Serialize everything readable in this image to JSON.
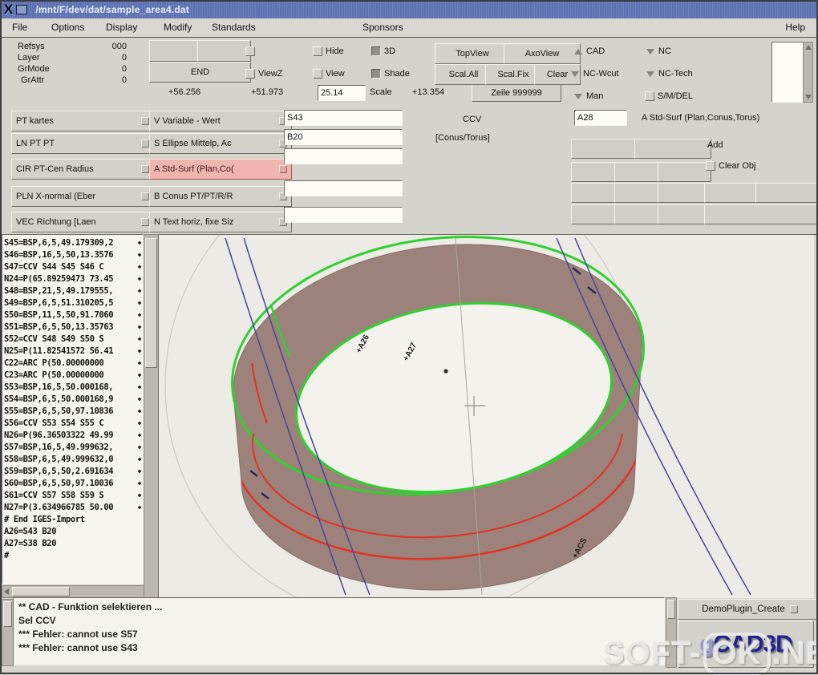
{
  "window": {
    "logo": "X",
    "title": "/mnt/F/dev/dat/sample_area4.dat",
    "buttons": {
      "minimize": "•",
      "maximize": "▫",
      "close": "✕"
    }
  },
  "menubar": {
    "items": [
      "File",
      "Options",
      "Display",
      "Modify",
      "Standards",
      "Sponsors"
    ],
    "help": "Help"
  },
  "toolbar": {
    "stats": [
      {
        "label": "Refsys",
        "value": "000"
      },
      {
        "label": "Layer",
        "value": "0"
      },
      {
        "label": "GrMode",
        "value": "0"
      },
      {
        "label": "GrAttr",
        "value": "0"
      }
    ],
    "end_button": "END",
    "coord_x": "+56.256",
    "coord_y": "+51.973",
    "scale_value": "25.14",
    "scale_label": "Scale",
    "coord_z": "+13.354",
    "line_label": "Zeile 999999",
    "toggles": {
      "viewz": "ViewZ",
      "hide": "Hide",
      "view": "View",
      "threed": "3D",
      "shade": "Shade",
      "smdel": "S/M/DEL"
    },
    "view_buttons": [
      "TopView",
      "AxoView",
      "Scal.All",
      "Scal.Fix",
      "Clear"
    ],
    "modes": [
      "CAD",
      "NC",
      "NC-Wcut",
      "NC-Tech",
      "Man"
    ]
  },
  "form": {
    "col1": [
      "PT kartes",
      "LN PT  PT",
      "CIR PT-Cen Radius",
      "PLN X-normal (Eber",
      "VEC Richtung  [Laen"
    ],
    "col2": [
      "V Variable - Wert",
      "S Ellipse Mittelp, Ac",
      "A Std-Surf (Plan,Co(",
      "B Conus PT/PT/R/R",
      "N Text horiz, fixe Siz"
    ],
    "inputs": [
      "S43",
      "B20",
      "",
      "",
      ""
    ],
    "ccv_title": "CCV",
    "ccv_sub": "[Conus/Torus]",
    "ccv_dots": [
      "·",
      "·",
      "·",
      "·"
    ],
    "obj_input": "A28",
    "obj_label": "A Std-Surf (Plan,Conus,Torus)",
    "add_label": "Add",
    "clear_obj": "Clear Obj"
  },
  "history": {
    "lines": [
      {
        "text": "S45=BSP,6,5,49.179309,2",
        "mark": "◆"
      },
      {
        "text": "S46=BSP,16,5,50,13.3576",
        "mark": "◆"
      },
      {
        "text": "S47=CCV S44 S45 S46 C",
        "mark": "◆"
      },
      {
        "text": "N24=P(65.89259473 73.45",
        "mark": "◆"
      },
      {
        "text": "S48=BSP,21,5,49.179555,",
        "mark": "◆"
      },
      {
        "text": "S49=BSP,6,5,51.310205,5",
        "mark": "◆"
      },
      {
        "text": "S50=BSP,11,5,50,91.7060",
        "mark": "◆"
      },
      {
        "text": "S51=BSP,6,5,50,13.35763",
        "mark": "◆"
      },
      {
        "text": "S52=CCV S48 S49 S50 S",
        "mark": "◆"
      },
      {
        "text": "N25=P(11.82541572 56.41",
        "mark": "◆"
      },
      {
        "text": "C22=ARC P(50.00000000",
        "mark": "◆"
      },
      {
        "text": "C23=ARC P(50.00000000",
        "mark": "◆"
      },
      {
        "text": "S53=BSP,16,5,50.000168,",
        "mark": "◆"
      },
      {
        "text": "S54=BSP,6,5,50.000168,9",
        "mark": "◆"
      },
      {
        "text": "S55=BSP,6,5,50,97.10836",
        "mark": "◆"
      },
      {
        "text": "S56=CCV S53 S54 S55 C",
        "mark": "◆"
      },
      {
        "text": "N26=P(96.36503322 49.99",
        "mark": "◆"
      },
      {
        "text": "S57=BSP,16,5,49.999632,",
        "mark": "◆"
      },
      {
        "text": "S58=BSP,6,5,49.999632,0",
        "mark": "◆"
      },
      {
        "text": "S59=BSP,6,5,50,2.691634",
        "mark": "◆"
      },
      {
        "text": "S60=BSP,6,5,50,97.10036",
        "mark": "◆"
      },
      {
        "text": "S61=CCV S57 S58 S59 S",
        "mark": "◆"
      },
      {
        "text": "N27=P(3.634966785 50.00",
        "mark": "◆"
      },
      {
        "text": "# End IGES-Import",
        "mark": ""
      },
      {
        "text": "A26=S43 B20",
        "mark": ""
      },
      {
        "text": "A27=S38 B20",
        "mark": ""
      },
      {
        "text": "#",
        "mark": ""
      }
    ]
  },
  "console": {
    "lines": [
      "** CAD - Funktion selektieren ...",
      "Sel CCV",
      "*** Fehler: cannot use S57",
      "*** Fehler: cannot use S43"
    ]
  },
  "plugin": {
    "button": "DemoPlugin_Create"
  },
  "logo": {
    "first": "g",
    "rest": "CAD3D"
  },
  "watermark": {
    "part1": "SOFT-",
    "part2": "OK",
    "part3": ".NET"
  },
  "canvas": {
    "labels": [
      "+A26",
      "+A27",
      "+ACS"
    ],
    "colors": {
      "surface": "#9c827b",
      "edge_green": "#2fd12f",
      "edge_red": "#e23222",
      "curve_blue": "#46469c",
      "background": "#ecebe6"
    }
  }
}
